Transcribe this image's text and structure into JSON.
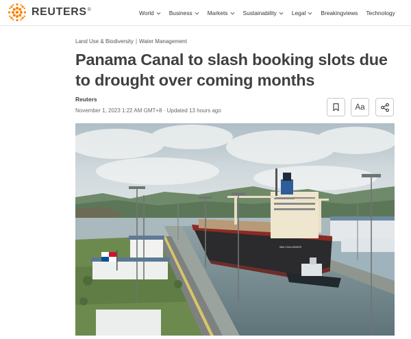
{
  "brand": {
    "name": "REUTERS",
    "trademark": "®"
  },
  "nav": {
    "items": [
      {
        "label": "World",
        "has_menu": true
      },
      {
        "label": "Business",
        "has_menu": true
      },
      {
        "label": "Markets",
        "has_menu": true
      },
      {
        "label": "Sustainability",
        "has_menu": true
      },
      {
        "label": "Legal",
        "has_menu": true
      },
      {
        "label": "Breakingviews",
        "has_menu": false
      },
      {
        "label": "Technology",
        "has_menu": false
      }
    ]
  },
  "article": {
    "categories": [
      "Land Use & Biodiversity",
      "Water Management"
    ],
    "category_separator": "|",
    "headline": "Panama Canal to slash booking slots due to drought over coming months",
    "byline": "Reuters",
    "timestamp": "November 1, 2023 1:22 AM GMT+8 · Updated 13 hours ago",
    "tools": {
      "text_size_label": "Aa"
    },
    "image": {
      "ship_name": "NBU CHALLENGER"
    }
  },
  "colors": {
    "brand_orange": "#ff8000",
    "text_dark": "#404040",
    "border": "#c8c8c8"
  },
  "icons": {
    "logo": "reuters-dot-logo",
    "menu_chevron": "chevron-down-icon",
    "bookmark": "bookmark-icon",
    "share": "share-icon"
  }
}
